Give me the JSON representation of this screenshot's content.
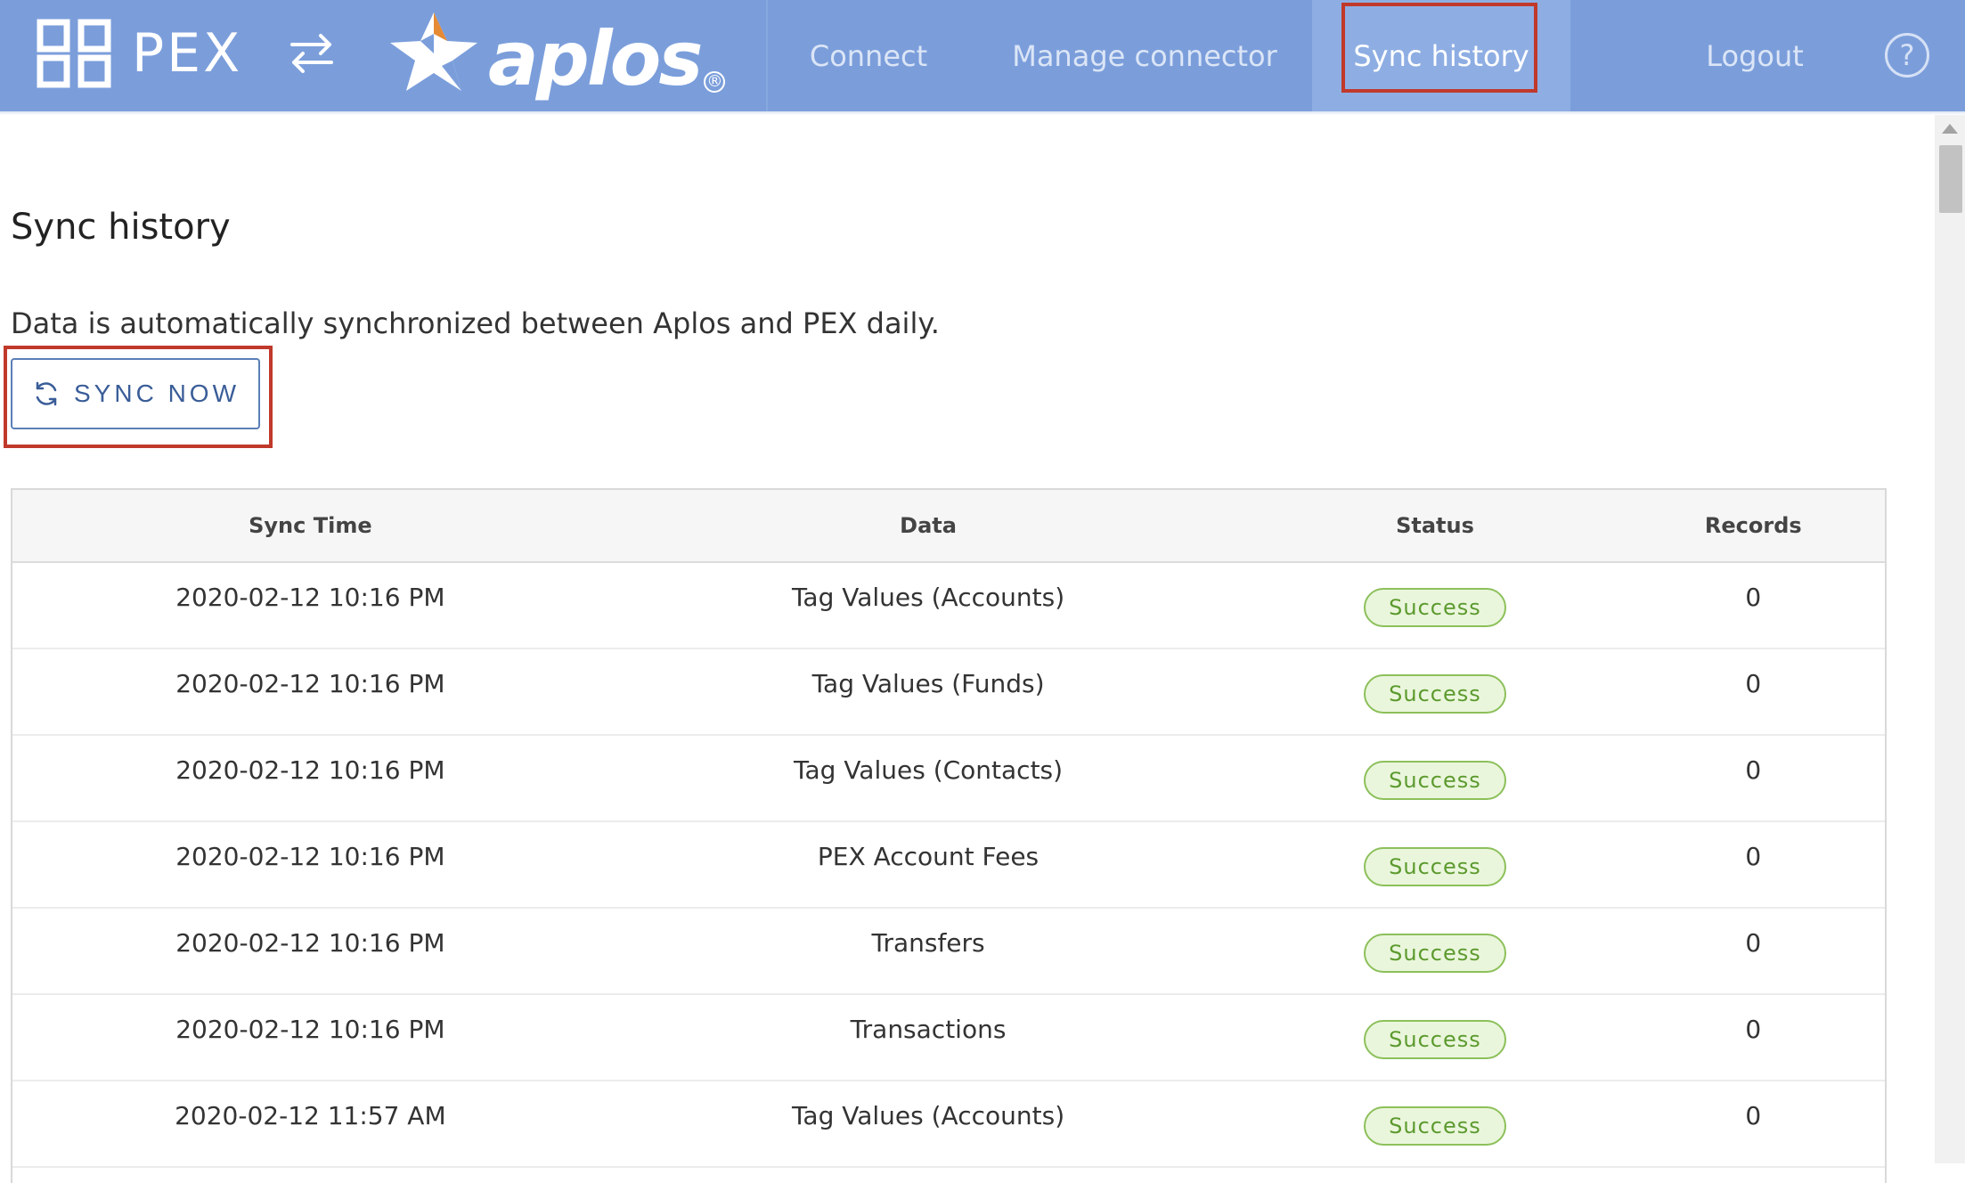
{
  "header": {
    "pex_logo_text": "PEX",
    "aplos_logo_text": "aplos",
    "aplos_registered": "®",
    "nav": {
      "connect": "Connect",
      "manage": "Manage connector",
      "sync_history": "Sync history",
      "logout": "Logout"
    },
    "help_glyph": "?"
  },
  "page": {
    "title": "Sync history",
    "description": "Data is automatically synchronized between Aplos and PEX daily.",
    "sync_button_label": "SYNC NOW"
  },
  "table": {
    "headers": [
      "Sync Time",
      "Data",
      "Status",
      "Records"
    ],
    "rows": [
      {
        "time": "2020-02-12 10:16 PM",
        "data": "Tag Values (Accounts)",
        "status": "Success",
        "records": "0"
      },
      {
        "time": "2020-02-12 10:16 PM",
        "data": "Tag Values (Funds)",
        "status": "Success",
        "records": "0"
      },
      {
        "time": "2020-02-12 10:16 PM",
        "data": "Tag Values (Contacts)",
        "status": "Success",
        "records": "0"
      },
      {
        "time": "2020-02-12 10:16 PM",
        "data": "PEX Account Fees",
        "status": "Success",
        "records": "0"
      },
      {
        "time": "2020-02-12 10:16 PM",
        "data": "Transfers",
        "status": "Success",
        "records": "0"
      },
      {
        "time": "2020-02-12 10:16 PM",
        "data": "Transactions",
        "status": "Success",
        "records": "0"
      },
      {
        "time": "2020-02-12 11:57 AM",
        "data": "Tag Values (Accounts)",
        "status": "Success",
        "records": "0"
      }
    ]
  },
  "colors": {
    "navbar": "#7b9edb",
    "active_tab": "#8eaee3",
    "highlight": "#c0392b",
    "success_text": "#5c9a2e",
    "success_bg": "#eaf6dc"
  },
  "icons": [
    "pex-logo-icon",
    "swap-arrows-icon",
    "aplos-star-icon",
    "help-icon",
    "refresh-icon"
  ]
}
